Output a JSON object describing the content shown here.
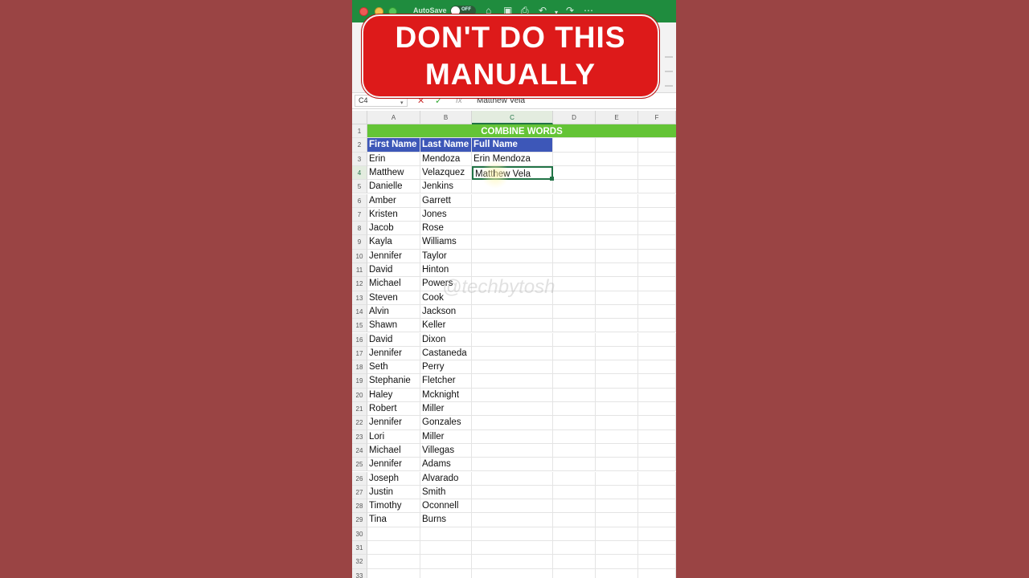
{
  "banner": {
    "line1": "DON'T DO THIS",
    "line2": "MANUALLY"
  },
  "titlebar": {
    "autosave_label": "AutoSave",
    "autosave_state": "OFF"
  },
  "formula_bar": {
    "cell_ref": "C4",
    "value": "Matthew Vela"
  },
  "columns": [
    "A",
    "B",
    "C",
    "D",
    "E",
    "F"
  ],
  "selected_column": "C",
  "sheet_title": "COMBINE WORDS",
  "headers": [
    "First Name",
    "Last Name",
    "Full Name"
  ],
  "rows": [
    {
      "num": "3",
      "first": "Erin",
      "last": "Mendoza",
      "full": "Erin Mendoza"
    },
    {
      "num": "4",
      "first": "Matthew",
      "last": "Velazquez",
      "full": "Matthew Vela"
    },
    {
      "num": "5",
      "first": "Danielle",
      "last": "Jenkins",
      "full": ""
    },
    {
      "num": "6",
      "first": "Amber",
      "last": "Garrett",
      "full": ""
    },
    {
      "num": "7",
      "first": "Kristen",
      "last": "Jones",
      "full": ""
    },
    {
      "num": "8",
      "first": "Jacob",
      "last": "Rose",
      "full": ""
    },
    {
      "num": "9",
      "first": "Kayla",
      "last": "Williams",
      "full": ""
    },
    {
      "num": "10",
      "first": "Jennifer",
      "last": "Taylor",
      "full": ""
    },
    {
      "num": "11",
      "first": "David",
      "last": "Hinton",
      "full": ""
    },
    {
      "num": "12",
      "first": "Michael",
      "last": "Powers",
      "full": ""
    },
    {
      "num": "13",
      "first": "Steven",
      "last": "Cook",
      "full": ""
    },
    {
      "num": "14",
      "first": "Alvin",
      "last": "Jackson",
      "full": ""
    },
    {
      "num": "15",
      "first": "Shawn",
      "last": "Keller",
      "full": ""
    },
    {
      "num": "16",
      "first": "David",
      "last": "Dixon",
      "full": ""
    },
    {
      "num": "17",
      "first": "Jennifer",
      "last": "Castaneda",
      "full": ""
    },
    {
      "num": "18",
      "first": "Seth",
      "last": "Perry",
      "full": ""
    },
    {
      "num": "19",
      "first": "Stephanie",
      "last": "Fletcher",
      "full": ""
    },
    {
      "num": "20",
      "first": "Haley",
      "last": "Mcknight",
      "full": ""
    },
    {
      "num": "21",
      "first": "Robert",
      "last": "Miller",
      "full": ""
    },
    {
      "num": "22",
      "first": "Jennifer",
      "last": "Gonzales",
      "full": ""
    },
    {
      "num": "23",
      "first": "Lori",
      "last": "Miller",
      "full": ""
    },
    {
      "num": "24",
      "first": "Michael",
      "last": "Villegas",
      "full": ""
    },
    {
      "num": "25",
      "first": "Jennifer",
      "last": "Adams",
      "full": ""
    },
    {
      "num": "26",
      "first": "Joseph",
      "last": "Alvarado",
      "full": ""
    },
    {
      "num": "27",
      "first": "Justin",
      "last": "Smith",
      "full": ""
    },
    {
      "num": "28",
      "first": "Timothy",
      "last": "Oconnell",
      "full": ""
    },
    {
      "num": "29",
      "first": "Tina",
      "last": "Burns",
      "full": ""
    }
  ],
  "empty_rows": [
    "30",
    "31",
    "32",
    "33"
  ],
  "watermark": "@techbytosh",
  "colors": {
    "title_fill": "#64c436",
    "header_fill": "#3d57b8",
    "excel_green": "#217346",
    "banner_red": "#dd1a1a"
  }
}
